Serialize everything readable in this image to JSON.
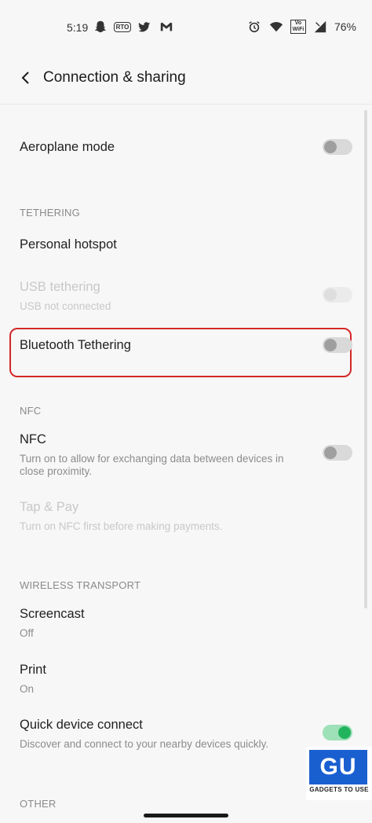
{
  "status_bar": {
    "time": "5:19",
    "left_icons": [
      "snapchat-icon",
      "rto-icon",
      "twitter-icon",
      "gmail-icon"
    ],
    "rto_label": "RTO",
    "right_icons": [
      "alarm-icon",
      "wifi-icon",
      "vowifi-icon",
      "signal-icon"
    ],
    "vowifi_line1": "Vo",
    "vowifi_line2": "WiFi",
    "battery": "76%"
  },
  "header": {
    "title": "Connection & sharing",
    "back_icon": "chevron-left-icon"
  },
  "rows": {
    "aeroplane": {
      "title": "Aeroplane mode",
      "enabled": true,
      "on": false
    },
    "section_tethering": "TETHERING",
    "hotspot": {
      "title": "Personal hotspot"
    },
    "usb": {
      "title": "USB tethering",
      "subtitle": "USB not connected",
      "enabled": false,
      "on": false
    },
    "bluetooth": {
      "title": "Bluetooth Tethering",
      "enabled": true,
      "on": false
    },
    "section_nfc": "NFC",
    "nfc": {
      "title": "NFC",
      "subtitle_line1": "Turn on to allow for exchanging data between devices in",
      "subtitle_line2": "close proximity.",
      "enabled": true,
      "on": false
    },
    "tap_pay": {
      "title": "Tap & Pay",
      "subtitle": "Turn on NFC first before making payments.",
      "enabled": false
    },
    "section_wireless": "WIRELESS TRANSPORT",
    "screencast": {
      "title": "Screencast",
      "subtitle": "Off"
    },
    "print": {
      "title": "Print",
      "subtitle": "On"
    },
    "quick_connect": {
      "title": "Quick device connect",
      "subtitle": "Discover and connect to your nearby devices quickly.",
      "enabled": true,
      "on": true
    },
    "section_other": "OTHER"
  },
  "colors": {
    "background": "#f7f7f7",
    "highlight_border": "#d32828",
    "toggle_on": "#21b45c",
    "watermark_blue": "#1a5fd0"
  },
  "watermark": {
    "logo_text": "GU",
    "caption": "GADGETS TO USE"
  }
}
